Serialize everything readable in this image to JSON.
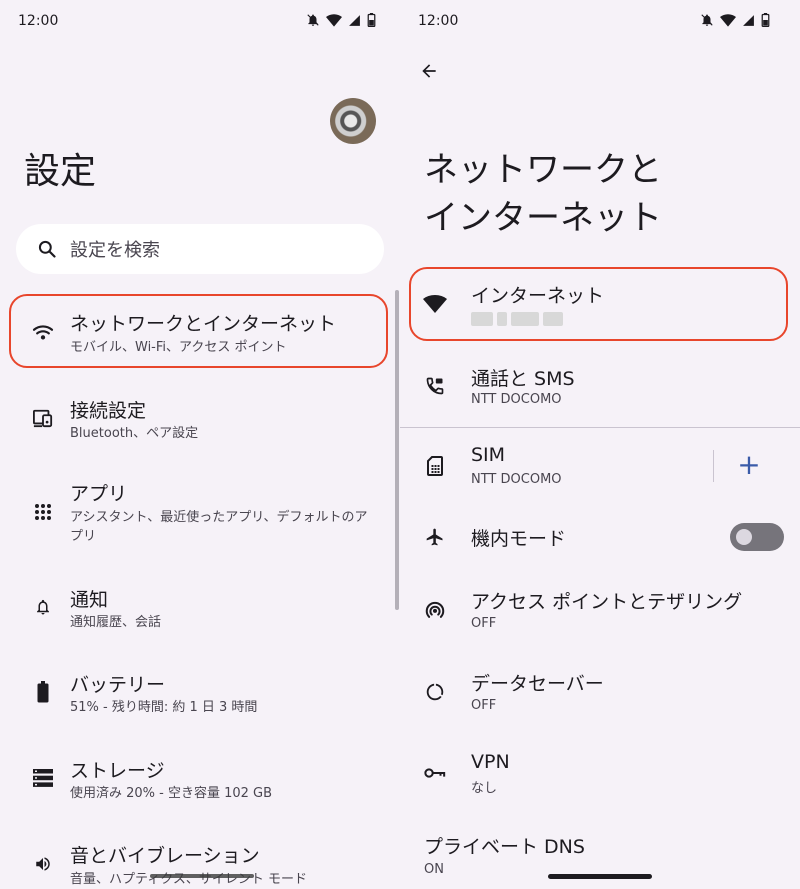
{
  "left_screen": {
    "status_time": "12:00",
    "title": "設定",
    "search_placeholder": "設定を検索",
    "items": [
      {
        "title": "ネットワークとインターネット",
        "subtitle": "モバイル、Wi-Fi、アクセス ポイント",
        "icon": "wifi-icon",
        "highlighted": true
      },
      {
        "title": "接続設定",
        "subtitle": "Bluetooth、ペア設定",
        "icon": "devices-icon"
      },
      {
        "title": "アプリ",
        "subtitle": "アシスタント、最近使ったアプリ、デフォルトのアプリ",
        "icon": "apps-grid-icon"
      },
      {
        "title": "通知",
        "subtitle": "通知履歴、会話",
        "icon": "bell-icon"
      },
      {
        "title": "バッテリー",
        "subtitle": "51% - 残り時間: 約 1 日 3 時間",
        "icon": "battery-icon"
      },
      {
        "title": "ストレージ",
        "subtitle": "使用済み 20% - 空き容量 102 GB",
        "icon": "storage-icon"
      },
      {
        "title": "音とバイブレーション",
        "subtitle": "音量、ハプティクス、サイレント モード",
        "icon": "volume-icon"
      }
    ]
  },
  "right_screen": {
    "status_time": "12:00",
    "title_line1": "ネットワークと",
    "title_line2": "インターネット",
    "items": [
      {
        "title": "インターネット",
        "subtitle": "",
        "icon": "wifi-icon",
        "highlighted": true
      },
      {
        "title": "通話と SMS",
        "subtitle": "NTT DOCOMO",
        "icon": "phone-sms-icon"
      },
      {
        "title": "SIM",
        "subtitle": "NTT DOCOMO",
        "icon": "sim-card-icon"
      },
      {
        "title": "機内モード",
        "subtitle": "",
        "icon": "airplane-icon",
        "toggle": "off"
      },
      {
        "title": "アクセス ポイントとテザリング",
        "subtitle": "OFF",
        "icon": "hotspot-icon"
      },
      {
        "title": "データセーバー",
        "subtitle": "OFF",
        "icon": "data-saver-icon"
      },
      {
        "title": "VPN",
        "subtitle": "なし",
        "icon": "vpn-key-icon"
      },
      {
        "title": "プライベート DNS",
        "subtitle": "ON"
      }
    ],
    "sim_add_label": "+"
  },
  "colors": {
    "background": "#f6f2f8",
    "highlight": "#e8462c",
    "accent": "#3a5ba9"
  }
}
